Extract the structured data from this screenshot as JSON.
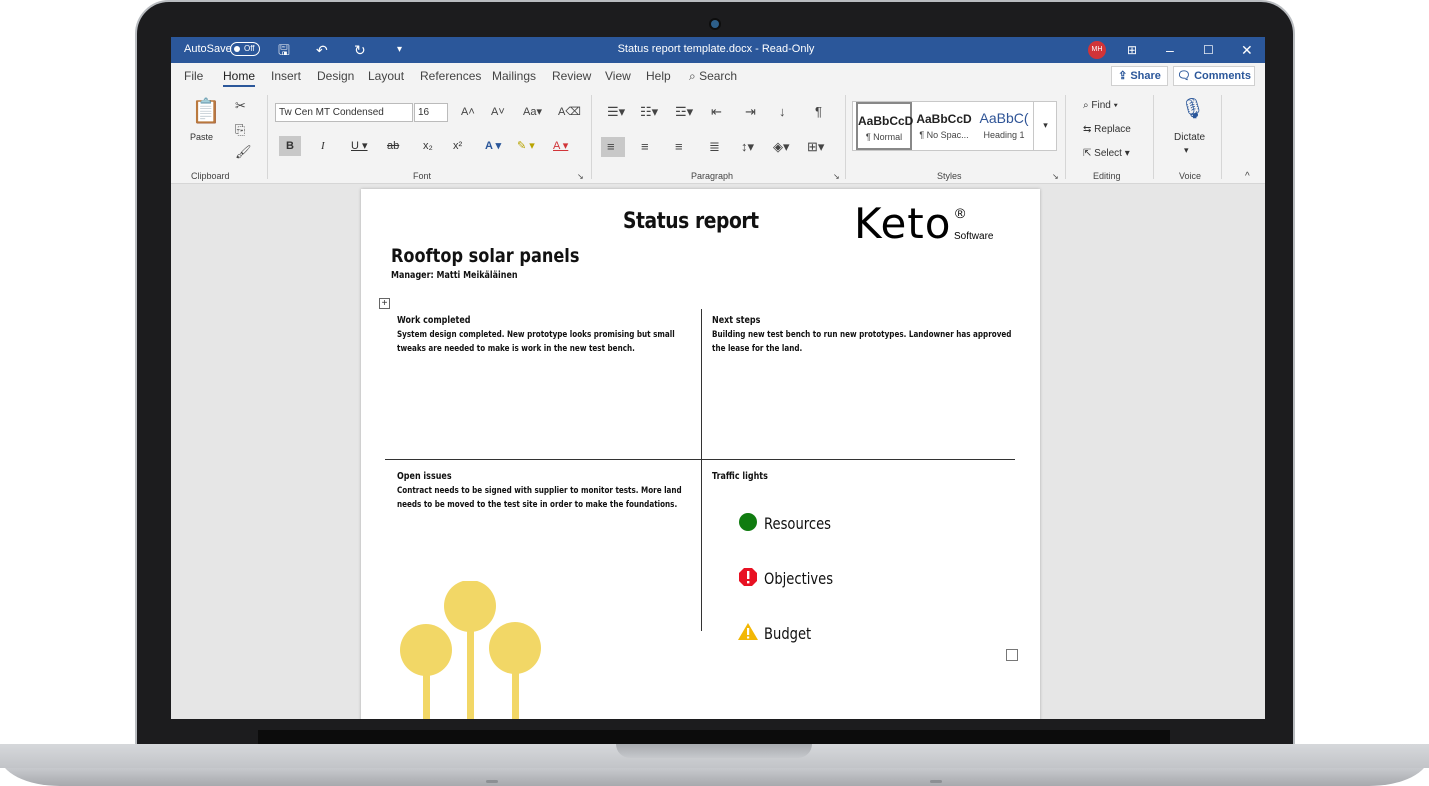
{
  "titlebar": {
    "autosave": "AutoSave",
    "autosave_state": "Off",
    "title": "Status report template.docx  -  Read-Only",
    "user_initials": "MH"
  },
  "menu": {
    "items": [
      "File",
      "Home",
      "Insert",
      "Design",
      "Layout",
      "References",
      "Mailings",
      "Review",
      "View",
      "Help"
    ],
    "search": "Search",
    "share": "Share",
    "comments": "Comments"
  },
  "ribbon": {
    "clipboard": {
      "paste": "Paste",
      "label": "Clipboard"
    },
    "font": {
      "name": "Tw Cen MT Condensed",
      "size": "16",
      "label": "Font",
      "case": "Aa"
    },
    "paragraph": {
      "label": "Paragraph"
    },
    "styles": {
      "label": "Styles",
      "items": [
        {
          "sample": "AaBbCcD",
          "name": "¶ Normal"
        },
        {
          "sample": "AaBbCcD",
          "name": "¶ No Spac..."
        },
        {
          "sample": "AaBbC(",
          "name": "Heading 1"
        }
      ]
    },
    "editing": {
      "find": "Find",
      "replace": "Replace",
      "select": "Select",
      "label": "Editing"
    },
    "voice": {
      "dictate": "Dictate",
      "label": "Voice"
    }
  },
  "document": {
    "title": "Status report",
    "logo": {
      "main": "Keto",
      "reg": "®",
      "sub": "Software"
    },
    "project": "Rooftop solar panels",
    "manager": "Manager: Matti Meikäläinen",
    "work_completed": {
      "heading": "Work completed",
      "body": "System design completed. New prototype looks promising but small tweaks are needed to make is work in the new test bench."
    },
    "next_steps": {
      "heading": "Next steps",
      "body": "Building new test  bench to run new prototypes. Landowner has approved the lease for the land."
    },
    "open_issues": {
      "heading": "Open issues",
      "body": "Contract needs to be signed with supplier to monitor tests. More land needs to be moved to the test site in order to make the foundations."
    },
    "traffic_lights": {
      "heading": "Traffic lights",
      "items": [
        {
          "label": "Resources",
          "status": "green",
          "color": "#107c10"
        },
        {
          "label": "Objectives",
          "status": "red",
          "color": "#e81123"
        },
        {
          "label": "Budget",
          "status": "warning",
          "color": "#f2b705"
        }
      ]
    },
    "decor_color": "#f2d766"
  }
}
